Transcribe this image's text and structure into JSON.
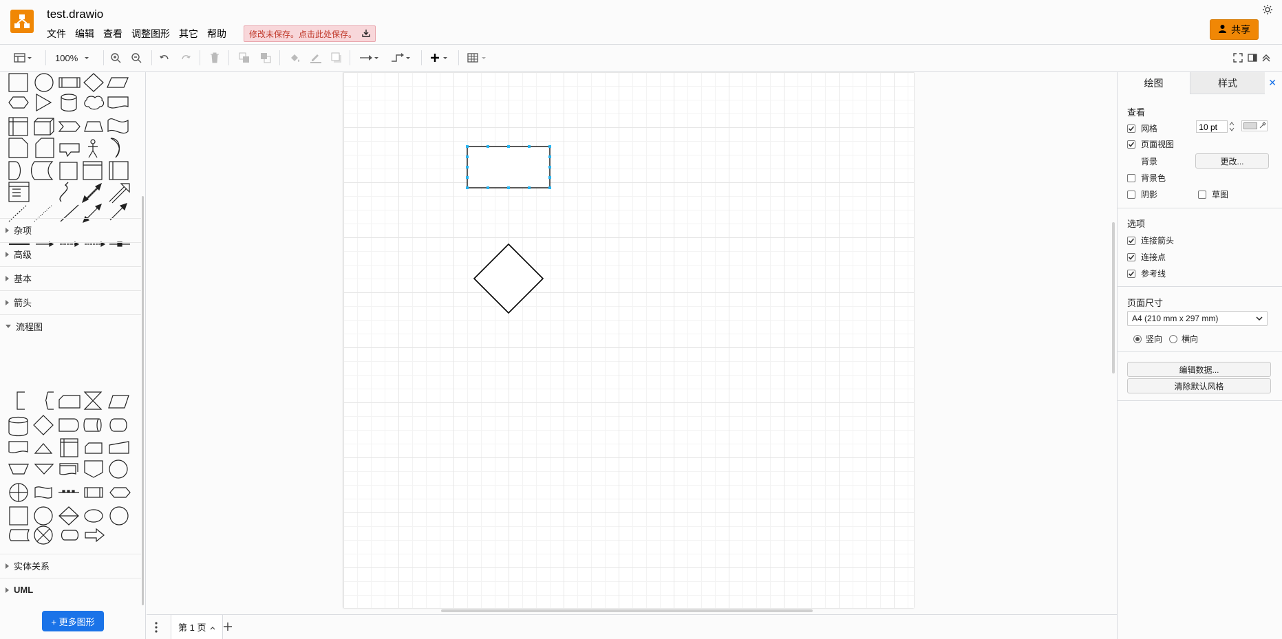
{
  "header": {
    "title": "test.drawio",
    "menus": [
      "文件",
      "编辑",
      "查看",
      "调整图形",
      "其它",
      "帮助"
    ],
    "unsaved_notice": "修改未保存。点击此处保存。",
    "share_label": "共享"
  },
  "toolbar": {
    "zoom": "100%"
  },
  "sidebar": {
    "categories": [
      {
        "label": "杂项",
        "expanded": false
      },
      {
        "label": "高级",
        "expanded": false
      },
      {
        "label": "基本",
        "expanded": false
      },
      {
        "label": "箭头",
        "expanded": false
      },
      {
        "label": "流程图",
        "expanded": true
      },
      {
        "label": "实体关系",
        "expanded": false
      },
      {
        "label": "UML",
        "expanded": false
      }
    ],
    "more_shapes": "+ 更多图形"
  },
  "pages": {
    "current_tab": "第 1 页"
  },
  "right_panel": {
    "tabs": [
      "绘图",
      "样式"
    ],
    "close": "✕",
    "view": {
      "title": "查看",
      "grid_label": "网格",
      "grid_checked": true,
      "grid_size": "10 pt",
      "page_view_label": "页面视图",
      "page_view_checked": true,
      "background_label": "背景",
      "change_button": "更改...",
      "bg_color_label": "背景色",
      "bg_color_checked": false,
      "shadow_label": "阴影",
      "shadow_checked": false,
      "sketch_label": "草图",
      "sketch_checked": false
    },
    "options": {
      "title": "选项",
      "connection_arrows": "连接箭头",
      "connection_points": "连接点",
      "guides": "参考线"
    },
    "page_size": {
      "title": "页面尺寸",
      "value": "A4 (210 mm x 297 mm)",
      "portrait": "竖向",
      "landscape": "横向",
      "orientation": "portrait"
    },
    "edit_data_button": "编辑数据...",
    "clear_style_button": "清除默认风格"
  },
  "colors": {
    "brand": "#f08705",
    "accent": "#1a73e8",
    "selection": "#29b6f2"
  }
}
